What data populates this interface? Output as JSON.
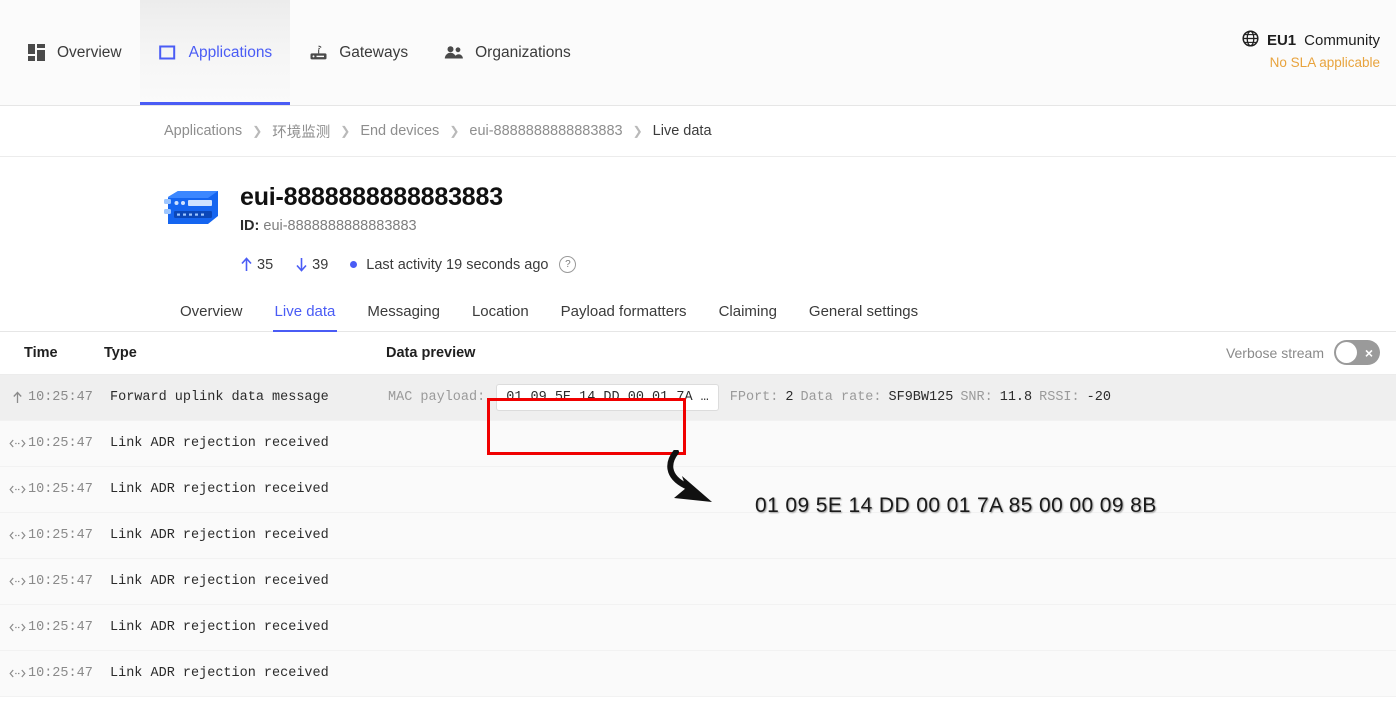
{
  "topnav": {
    "items": [
      {
        "label": "Overview",
        "icon": "grid-icon",
        "active": false
      },
      {
        "label": "Applications",
        "icon": "square-icon",
        "active": true
      },
      {
        "label": "Gateways",
        "icon": "router-icon",
        "active": false
      },
      {
        "label": "Organizations",
        "icon": "people-icon",
        "active": false
      }
    ],
    "cluster": {
      "name": "EU1",
      "plan": "Community",
      "sla": "No SLA applicable",
      "icon": "globe-icon"
    }
  },
  "breadcrumb": [
    "Applications",
    "环境监测",
    "End devices",
    "eui-8888888888883883",
    "Live data"
  ],
  "device": {
    "icon": "device-module-icon",
    "title": "eui-8888888888883883",
    "id_label": "ID:",
    "id_value": "eui-8888888888883883",
    "uplink_count": "35",
    "downlink_count": "39",
    "last_activity": "Last activity 19 seconds ago",
    "help_icon": "question-circle-icon"
  },
  "tabs": [
    {
      "label": "Overview",
      "active": false
    },
    {
      "label": "Live data",
      "active": true
    },
    {
      "label": "Messaging",
      "active": false
    },
    {
      "label": "Location",
      "active": false
    },
    {
      "label": "Payload formatters",
      "active": false
    },
    {
      "label": "Claiming",
      "active": false
    },
    {
      "label": "General settings",
      "active": false
    }
  ],
  "table": {
    "headers": {
      "time": "Time",
      "type": "Type",
      "data": "Data preview"
    },
    "verbose_stream": {
      "label": "Verbose stream",
      "state": "off",
      "off_glyph": "×"
    },
    "rows": [
      {
        "direction": "uplink",
        "icon": "arrow-up-icon",
        "time": "10:25:47",
        "type": "Forward uplink data message",
        "highlighted": true,
        "fields": [
          {
            "label": "MAC payload:",
            "value": "01 09 5E 14 DD 00 01 7A …",
            "chip": true
          },
          {
            "label": "FPort:",
            "value": "2",
            "chip": false
          },
          {
            "label": "Data rate:",
            "value": "SF9BW125",
            "chip": false
          },
          {
            "label": "SNR:",
            "value": "11.8",
            "chip": false
          },
          {
            "label": "RSSI:",
            "value": "-20",
            "chip": false
          }
        ]
      },
      {
        "direction": "both",
        "icon": "arrow-left-right-icon",
        "time": "10:25:47",
        "type": "Link ADR rejection received",
        "highlighted": false,
        "fields": []
      },
      {
        "direction": "both",
        "icon": "arrow-left-right-icon",
        "time": "10:25:47",
        "type": "Link ADR rejection received",
        "highlighted": false,
        "fields": []
      },
      {
        "direction": "both",
        "icon": "arrow-left-right-icon",
        "time": "10:25:47",
        "type": "Link ADR rejection received",
        "highlighted": false,
        "fields": []
      },
      {
        "direction": "both",
        "icon": "arrow-left-right-icon",
        "time": "10:25:47",
        "type": "Link ADR rejection received",
        "highlighted": false,
        "fields": []
      },
      {
        "direction": "both",
        "icon": "arrow-left-right-icon",
        "time": "10:25:47",
        "type": "Link ADR rejection received",
        "highlighted": false,
        "fields": []
      },
      {
        "direction": "both",
        "icon": "arrow-left-right-icon",
        "time": "10:25:47",
        "type": "Link ADR rejection received",
        "highlighted": false,
        "fields": []
      }
    ]
  },
  "annotation": {
    "box_color": "#f00000",
    "callout_text": "01 09 5E 14 DD 00 01 7A 85 00 00 09 8B",
    "arrow": "curved-arrow-icon"
  },
  "colors": {
    "accent": "#4a5cf5",
    "warning": "#e8a33d",
    "annotation_red": "#f00000",
    "row_highlight": "#efefef"
  }
}
